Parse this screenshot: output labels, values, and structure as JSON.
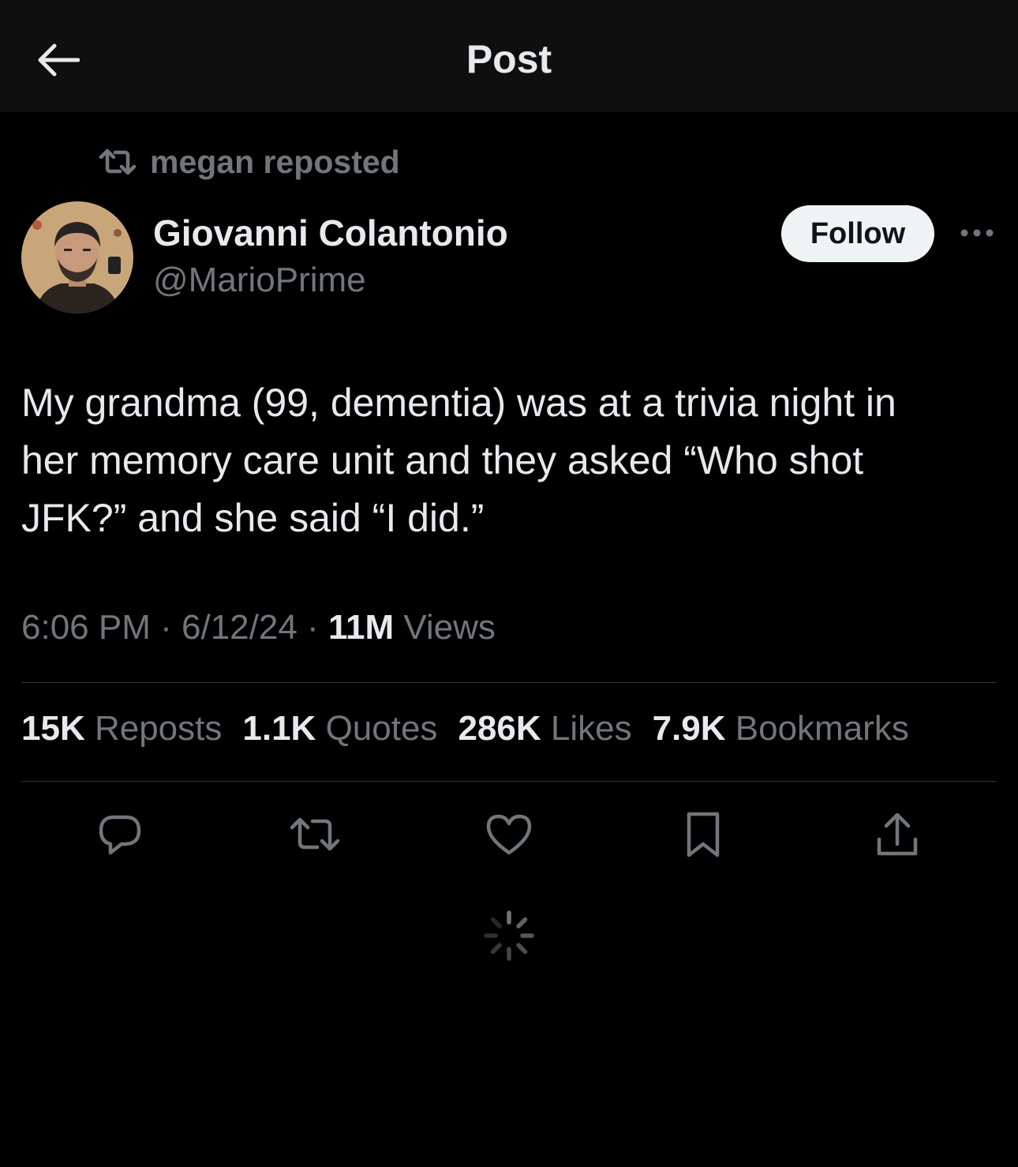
{
  "header": {
    "title": "Post",
    "back_icon": "arrow-left-icon"
  },
  "repost_banner": {
    "text": "megan reposted",
    "icon": "repost-icon"
  },
  "author": {
    "display_name": "Giovanni Colantonio",
    "handle": "@MarioPrime",
    "follow_label": "Follow",
    "more_icon": "more-dots-icon"
  },
  "tweet": {
    "text": "My grandma (99, dementia) was at a trivia night in\nher memory care unit and they asked “Who shot\nJFK?” and she said “I did.”",
    "time": "6:06 PM",
    "date": "6/12/24",
    "views_count": "11M",
    "views_label": "Views",
    "separator": "·"
  },
  "stats": [
    {
      "count": "15K",
      "label": "Reposts"
    },
    {
      "count": "1.1K",
      "label": "Quotes"
    },
    {
      "count": "286K",
      "label": "Likes"
    },
    {
      "count": "7.9K",
      "label": "Bookmarks"
    }
  ],
  "actions": [
    "reply-icon",
    "repost-icon",
    "like-icon",
    "bookmark-icon",
    "share-icon"
  ],
  "colors": {
    "background": "#000000",
    "header_bg": "#0f0f0f",
    "text_primary": "#e7e9ea",
    "text_secondary": "#71767b",
    "divider": "#2f3336",
    "follow_bg": "#eff3f4"
  }
}
